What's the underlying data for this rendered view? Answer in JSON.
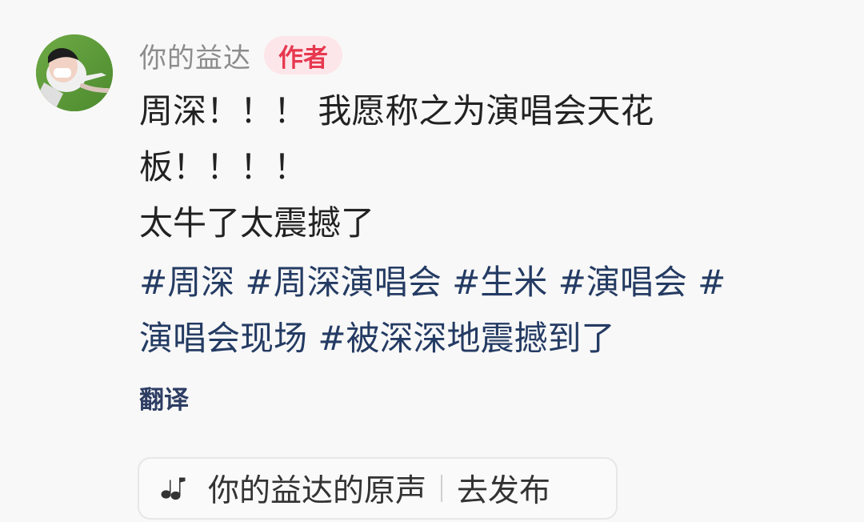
{
  "comment": {
    "author": "你的益达",
    "author_tag": "作者",
    "text_lines": [
      "周深！！！ 我愿称之为演唱会天花",
      "板！！！！",
      "太牛了太震撼了"
    ],
    "hashtags_line1": "#周深 #周深演唱会 #生米 #演唱会 #",
    "hashtags_line2": "演唱会现场 #被深深地震撼到了",
    "translate_label": "翻译",
    "sound_label": "你的益达的原声",
    "publish_label": "去发布",
    "music_icon": "music-note-icon",
    "colors": {
      "author_tag_bg": "#fde6ea",
      "author_tag_text": "#e7384f",
      "hashtag_text": "#243b63"
    }
  }
}
